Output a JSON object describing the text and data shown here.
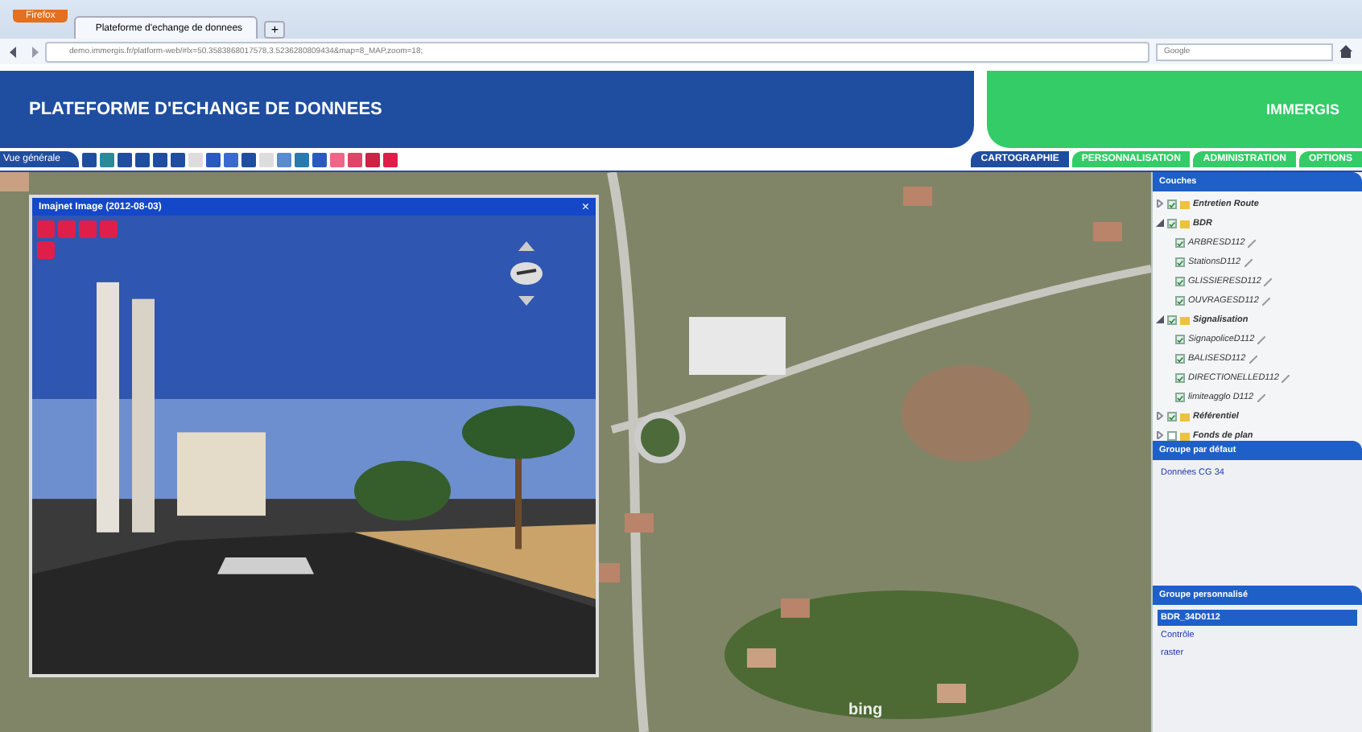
{
  "browser": {
    "menu_button": "Firefox",
    "tab_title": "Plateforme d'echange de donnees",
    "new_tab": "+",
    "url": "demo.immergis.fr/platform-web/#lx=50.3583868017578,3.5236280809434&map=8_MAP,zoom=18;",
    "search_placeholder": "Google"
  },
  "header": {
    "title": "PLATEFORME D'ECHANGE DE DONNEES",
    "brand": "IMMERGIS"
  },
  "toolbar": {
    "view_label": "Vue générale"
  },
  "nav_tabs": [
    {
      "label": "CARTOGRAPHIE",
      "selected": true
    },
    {
      "label": "PERSONNALISATION",
      "selected": false
    },
    {
      "label": "ADMINISTRATION",
      "selected": false
    },
    {
      "label": "OPTIONS",
      "selected": false
    }
  ],
  "viewer": {
    "title": "Imajnet Image (2012-08-03)",
    "close": "×"
  },
  "layers": {
    "title": "Couches",
    "items": [
      {
        "label": "Entretien Route",
        "checked": true,
        "expanded": false
      },
      {
        "label": "BDR",
        "checked": true,
        "expanded": true,
        "children": [
          {
            "label": "ARBRESD112",
            "checked": true
          },
          {
            "label": "StationsD112",
            "checked": true
          },
          {
            "label": "GLISSIERESD112",
            "checked": true
          },
          {
            "label": "OUVRAGESD112",
            "checked": true
          }
        ]
      },
      {
        "label": "Signalisation",
        "checked": true,
        "expanded": true,
        "children": [
          {
            "label": "SignapoliceD112",
            "checked": true
          },
          {
            "label": "BALISESD112",
            "checked": true
          },
          {
            "label": "DIRECTIONELLED112",
            "checked": true
          },
          {
            "label": "limiteagglo D112",
            "checked": true
          }
        ]
      },
      {
        "label": "Référentiel",
        "checked": true,
        "expanded": false
      },
      {
        "label": "Fonds de plan",
        "checked": false,
        "expanded": false
      }
    ]
  },
  "default_group": {
    "title": "Groupe par défaut",
    "items": [
      {
        "label": "Données CG 34",
        "selected": false
      }
    ]
  },
  "custom_group": {
    "title": "Groupe personnalisé",
    "items": [
      {
        "label": "BDR_34D0112",
        "selected": true
      },
      {
        "label": "Contrôle",
        "selected": false
      },
      {
        "label": "raster",
        "selected": false
      }
    ]
  },
  "map": {
    "attribution": "bing"
  }
}
